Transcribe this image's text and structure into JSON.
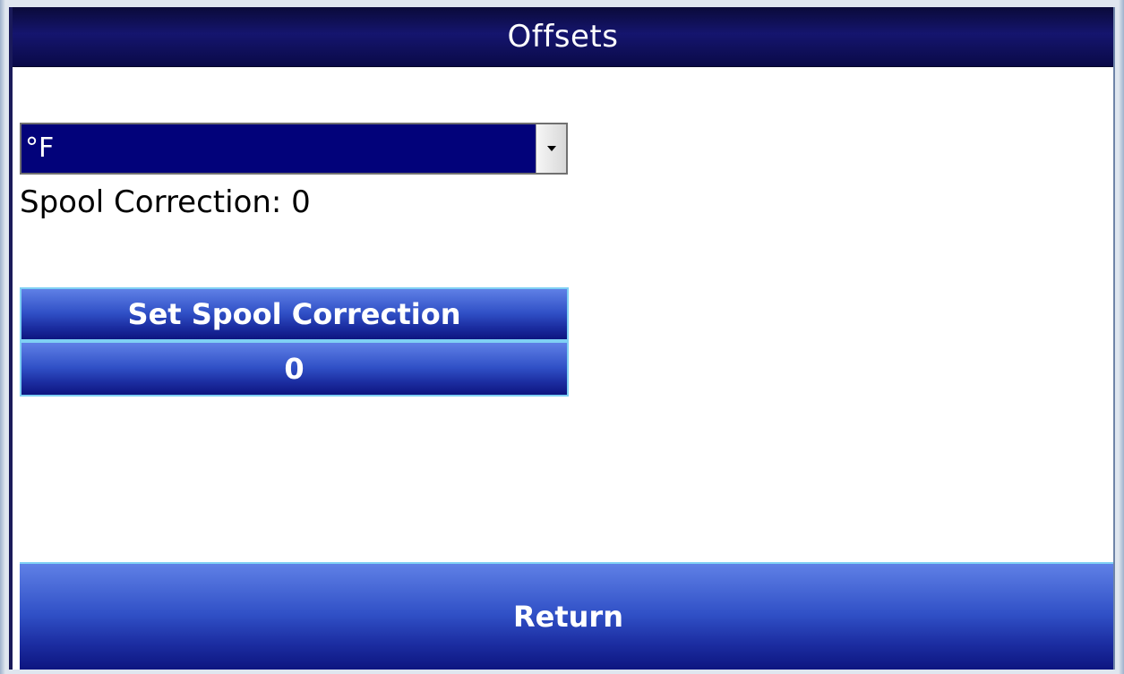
{
  "window": {
    "title": "Offsets"
  },
  "units": {
    "selected": "°F"
  },
  "spool": {
    "status_label": "Spool Correction: 0",
    "set_button_label": "Set Spool Correction",
    "value_button_label": "0"
  },
  "footer": {
    "return_label": "Return"
  },
  "colors": {
    "title_bar": "#0a0a48",
    "select_highlight": "#02027a",
    "button_top": "#5f80e6",
    "button_bottom": "#0d1580",
    "button_border": "#7fd0f4"
  },
  "icons": {
    "dropdown": "chevron-down-icon"
  }
}
